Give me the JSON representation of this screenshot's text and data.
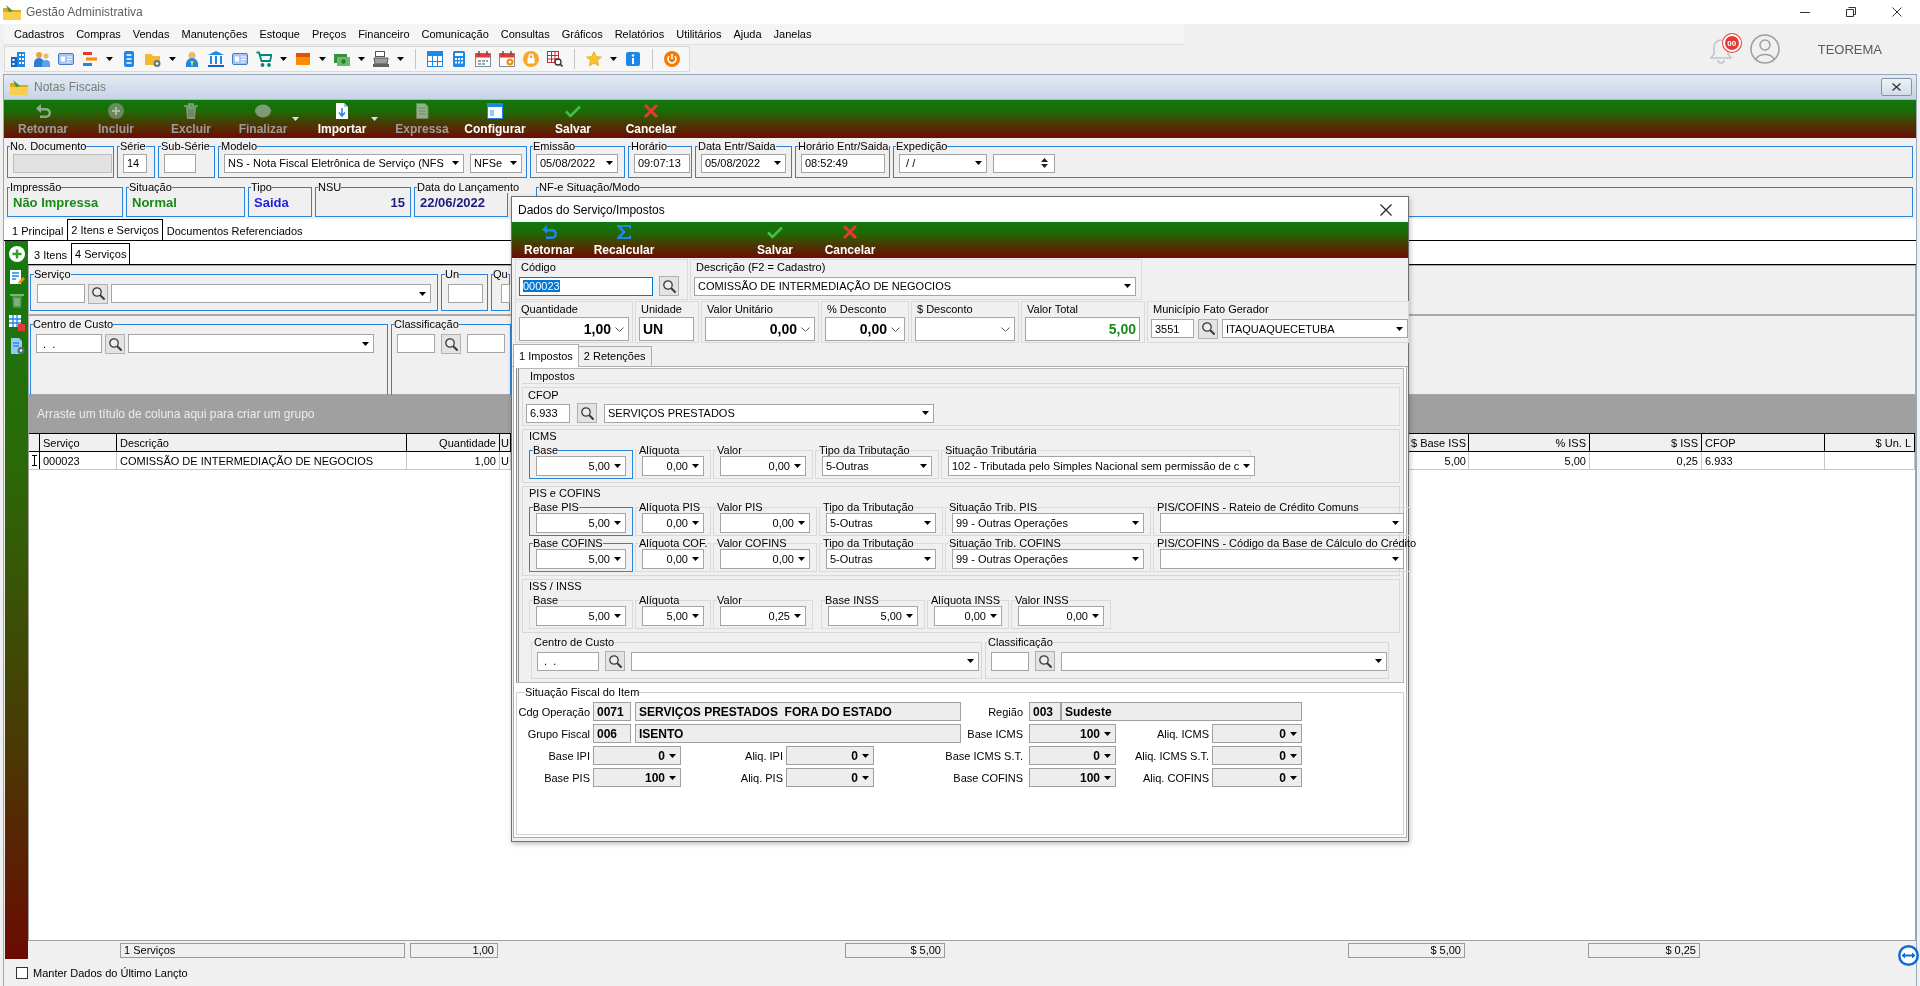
{
  "app": {
    "title": "Gestão Administrativa",
    "notifications": "00",
    "user": "TEOREMA"
  },
  "menu": [
    "Cadastros",
    "Compras",
    "Vendas",
    "Manutenções",
    "Estoque",
    "Preços",
    "Financeiro",
    "Comunicação",
    "Consultas",
    "Gráficos",
    "Relatórios",
    "Utilitários",
    "Ajuda",
    "Janelas"
  ],
  "document_window": {
    "title": "Notas Fiscais",
    "actions": [
      {
        "label": "Retornar",
        "disabled": true,
        "dropdown": false
      },
      {
        "label": "Incluir",
        "disabled": true,
        "dropdown": false
      },
      {
        "label": "Excluir",
        "disabled": true,
        "dropdown": false
      },
      {
        "label": "Finalizar",
        "disabled": true,
        "dropdown": true
      },
      {
        "label": "Importar",
        "disabled": false,
        "dropdown": true
      },
      {
        "label": "Expressa",
        "disabled": true,
        "dropdown": false
      },
      {
        "label": "Configurar",
        "disabled": false,
        "dropdown": false
      },
      {
        "label": "Salvar",
        "disabled": false,
        "dropdown": false
      },
      {
        "label": "Cancelar",
        "disabled": false,
        "dropdown": false
      }
    ],
    "header_fields": [
      {
        "label": "No. Documento",
        "controls": [
          {
            "kind": "input",
            "disabled": true
          }
        ]
      },
      {
        "label": "Série",
        "controls": [
          {
            "kind": "input",
            "value": "14",
            "disabled": false
          }
        ]
      },
      {
        "label": "Sub-Série",
        "controls": [
          {
            "kind": "input",
            "disabled": false
          }
        ]
      },
      {
        "label": "Modelo",
        "controls": [
          {
            "kind": "select",
            "value": "NS - Nota Fiscal Eletrônica de Serviço (NFS",
            "disabled": false
          },
          {
            "kind": "select",
            "value": "NFSe",
            "disabled": false
          }
        ]
      },
      {
        "label": "Emissão",
        "controls": [
          {
            "kind": "select",
            "value": "05/08/2022",
            "disabled": false
          }
        ]
      },
      {
        "label": "Horário",
        "controls": [
          {
            "kind": "input",
            "value": "09:07:13",
            "disabled": false
          }
        ]
      },
      {
        "label": "Data Entr/Saida",
        "controls": [
          {
            "kind": "select",
            "value": "05/08/2022",
            "disabled": false
          }
        ]
      },
      {
        "label": "Horário Entr/Saida",
        "controls": [
          {
            "kind": "input",
            "value": "08:52:49",
            "disabled": false
          }
        ]
      },
      {
        "label": "Expedição",
        "controls": [
          {
            "kind": "select",
            "value": " / /",
            "disabled": false
          },
          {
            "kind": "spin",
            "disabled": false
          }
        ]
      }
    ],
    "status_fields": [
      {
        "label": "Impressão",
        "value": "Não Impressa",
        "color": "#178a17"
      },
      {
        "label": "Situação",
        "value": "Normal",
        "color": "#178a17"
      },
      {
        "label": "Tipo",
        "value": "Saida",
        "color": "#1e1ee0"
      },
      {
        "label": "NSU",
        "value": "15",
        "color": "#1c1c78"
      },
      {
        "label": "Data do Lançamento",
        "value": "22/06/2022",
        "color": "#1c1c78"
      },
      {
        "label": "NF-e Situação/Modo"
      }
    ],
    "tabs": [
      {
        "label": "1 Principal",
        "selected": false
      },
      {
        "label": "2 Itens e Serviços",
        "selected": true
      },
      {
        "label": "Documentos Referenciados",
        "selected": false
      }
    ],
    "sub_tabs": [
      {
        "label": "3 Itens",
        "selected": false
      },
      {
        "label": "4 Serviços",
        "selected": true
      }
    ],
    "service_entry": [
      {
        "label": "Serviço",
        "controls": [
          {
            "kind": "input"
          },
          {
            "kind": "search"
          },
          {
            "kind": "select"
          }
        ]
      },
      {
        "label": "Un",
        "controls": [
          {
            "kind": "input"
          }
        ]
      },
      {
        "label": "Qu",
        "controls": [
          {
            "kind": "input"
          }
        ]
      }
    ],
    "cost_entry": [
      {
        "label": "Centro de Custo",
        "controls": [
          {
            "kind": "input",
            "value": " .  ."
          },
          {
            "kind": "search"
          },
          {
            "kind": "select"
          }
        ]
      },
      {
        "label": "Classificação",
        "controls": [
          {
            "kind": "input"
          },
          {
            "kind": "search"
          },
          {
            "kind": "input"
          }
        ]
      }
    ],
    "grid": {
      "group_hint": "Arraste um título de coluna aqui para criar um grupo",
      "columns": [
        "Serviço",
        "Descrição",
        "Quantidade",
        "U",
        "$ Base ISS",
        "% ISS",
        "$ ISS",
        "CFOP",
        "$ Un. L"
      ],
      "rows": [
        {
          "editing": true,
          "cells": [
            "000023",
            "COMISSÃO DE INTERMEDIAÇÃO DE NEGOCIOS",
            "1,00",
            "U",
            "5,00",
            "5,00",
            "0,25",
            "6.933"
          ]
        }
      ],
      "totals": [
        "1 Serviços",
        "1,00",
        "$ 5,00",
        "$ 5,00",
        "$ 0,25"
      ]
    },
    "keep_data": {
      "label": "Manter Dados do Último Lançto",
      "checked": false
    }
  },
  "dialog": {
    "title": "Dados do Serviço/Impostos",
    "actions": [
      {
        "label": "Retornar"
      },
      {
        "label": "Recalcular"
      },
      {
        "label": "Salvar"
      },
      {
        "label": "Cancelar"
      }
    ],
    "code": {
      "label": "Código",
      "value": "000023",
      "focused": true
    },
    "description": {
      "label": "Descrição (F2 = Cadastro)",
      "value": "COMISSÃO DE INTERMEDIAÇÃO DE NEGOCIOS"
    },
    "amounts": [
      {
        "label": "Quantidade",
        "kind": "number",
        "value": "1,00"
      },
      {
        "label": "Unidade",
        "kind": "text",
        "value": "UN"
      },
      {
        "label": "Valor Unitário",
        "kind": "number",
        "value": "0,00"
      },
      {
        "label": "% Desconto",
        "kind": "number",
        "value": "0,00"
      },
      {
        "label": "$ Desconto",
        "kind": "number"
      },
      {
        "label": "Valor Total",
        "kind": "total",
        "value": "5,00"
      },
      {
        "label": "Município Fato Gerador",
        "kind": "lookup",
        "code": "3551",
        "value": "ITAQUAQUECETUBA"
      }
    ],
    "tabs": [
      {
        "label": "1 Impostos",
        "selected": true
      },
      {
        "label": "2 Retenções",
        "selected": false
      }
    ],
    "taxes": {
      "title": "Impostos",
      "cfop": {
        "label": "CFOP",
        "code": "6.933",
        "value": "SERVIÇOS PRESTADOS"
      },
      "groups": [
        {
          "title": "ICMS",
          "rows": [
            [
              {
                "label": "Base",
                "kind": "amount",
                "value": "5,00",
                "highlighted": true
              },
              {
                "label": "Alíquota",
                "kind": "amount",
                "value": "0,00",
                "highlighted": false
              },
              {
                "label": "Valor",
                "kind": "amount",
                "value": "0,00",
                "highlighted": false
              },
              {
                "label": "Tipo da Tributação",
                "kind": "option",
                "value": "5-Outras",
                "highlighted": false
              },
              {
                "label": "Situação Tributária",
                "kind": "option",
                "value": "102 - Tributada pelo Simples Nacional sem permissão de c",
                "highlighted": false
              }
            ]
          ]
        },
        {
          "title": "PIS e COFINS",
          "rows": [
            [
              {
                "label": "Base PIS",
                "kind": "amount",
                "value": "5,00",
                "highlighted": true
              },
              {
                "label": "Alíquota PIS",
                "kind": "amount",
                "value": "0,00",
                "highlighted": false
              },
              {
                "label": "Valor PIS",
                "kind": "amount",
                "value": "0,00",
                "highlighted": false
              },
              {
                "label": "Tipo da Tributação",
                "kind": "option",
                "value": "5-Outras",
                "highlighted": false
              },
              {
                "label": "Situação Trib. PIS",
                "kind": "option",
                "value": "99 - Outras Operações",
                "highlighted": false
              },
              {
                "label": "PIS/COFINS - Rateio de Crédito Comuns",
                "kind": "option",
                "highlighted": false
              }
            ],
            [
              {
                "label": "Base COFINS",
                "kind": "amount",
                "value": "5,00",
                "highlighted": true
              },
              {
                "label": "Alíquota COF.",
                "kind": "amount",
                "value": "0,00",
                "highlighted": false
              },
              {
                "label": "Valor COFINS",
                "kind": "amount",
                "value": "0,00",
                "highlighted": false
              },
              {
                "label": "Tipo da Tributação",
                "kind": "option",
                "value": "5-Outras",
                "highlighted": false
              },
              {
                "label": "Situação Trib. COFINS",
                "kind": "option",
                "value": "99 - Outras Operações",
                "highlighted": false
              },
              {
                "label": "PIS/COFINS - Código da Base de Cálculo do Crédito",
                "kind": "option",
                "highlighted": false
              }
            ]
          ]
        },
        {
          "title": "ISS / INSS",
          "rows": [
            [
              {
                "label": "Base",
                "kind": "amount",
                "value": "5,00",
                "highlighted": false
              },
              {
                "label": "Alíquota",
                "kind": "amount",
                "value": "5,00",
                "highlighted": false
              },
              {
                "label": "Valor",
                "kind": "amount",
                "value": "0,25",
                "highlighted": false
              },
              {
                "label": "Base INSS",
                "kind": "amount",
                "value": "5,00",
                "highlighted": false
              },
              {
                "label": "Alíquota INSS",
                "kind": "amount",
                "value": "0,00",
                "highlighted": false
              },
              {
                "label": "Valor INSS",
                "kind": "amount",
                "value": "0,00",
                "highlighted": false
              }
            ]
          ]
        }
      ],
      "cost_center": {
        "label": "Centro de Custo",
        "value": " .  ."
      },
      "classification": {
        "label": "Classificação"
      }
    },
    "fiscal": {
      "title": "Situação Fiscal do Item",
      "operation": {
        "label": "Cdg Operação",
        "code": "0071",
        "value": "SERVIÇOS PRESTADOS  FORA DO ESTADO"
      },
      "region": {
        "label": "Região",
        "code": "003",
        "value": "Sudeste"
      },
      "group": {
        "label": "Grupo Fiscal",
        "code": "006",
        "value": "ISENTO"
      },
      "rates": [
        {
          "label": "Base ICMS",
          "value": "100"
        },
        {
          "label": "Aliq. ICMS",
          "value": "0"
        },
        {
          "label": "Base IPI",
          "value": "0"
        },
        {
          "label": "Aliq. IPI",
          "value": "0"
        },
        {
          "label": "Base ICMS S.T.",
          "value": "0"
        },
        {
          "label": "Aliq. ICMS S.T.",
          "value": "0"
        },
        {
          "label": "Base PIS",
          "value": "100"
        },
        {
          "label": "Aliq. PIS",
          "value": "0"
        },
        {
          "label": "Base COFINS",
          "value": "100"
        },
        {
          "label": "Aliq. COFINS",
          "value": "0"
        }
      ]
    }
  }
}
